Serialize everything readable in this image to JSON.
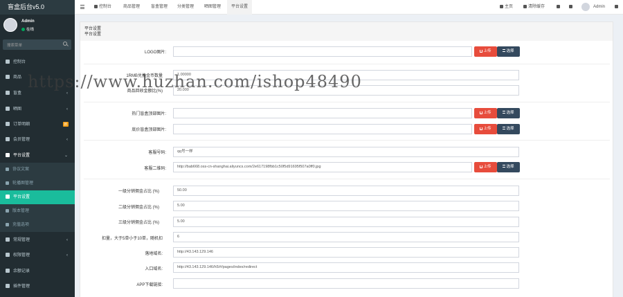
{
  "sidebar": {
    "logo": "盲盒后台v5.0",
    "user": {
      "name": "Admin",
      "status": "在线"
    },
    "search_placeholder": "搜索菜单",
    "items": [
      {
        "label": "控制台",
        "icon": "dashboard-icon"
      },
      {
        "label": "商品",
        "icon": "shopping-bag-icon"
      },
      {
        "label": "盲盒",
        "icon": "tag-icon",
        "caret": "‹"
      },
      {
        "label": "晒图",
        "icon": "image-icon",
        "caret": "‹"
      },
      {
        "label": "订单明细",
        "icon": "list-icon",
        "badge": "新"
      },
      {
        "label": "会员管理",
        "icon": "users-icon",
        "caret": "‹"
      },
      {
        "label": "平台设置",
        "icon": "gear-icon",
        "caret": "⌄"
      },
      {
        "label": "协议文案",
        "icon": "doc-icon"
      },
      {
        "label": "轮播图管理",
        "icon": "image-icon"
      },
      {
        "label": "平台设置",
        "icon": "gear-icon"
      },
      {
        "label": "版本管理",
        "icon": "version-icon"
      },
      {
        "label": "充值选项",
        "icon": "coin-icon"
      },
      {
        "label": "常规管理",
        "icon": "cogs-icon",
        "caret": "‹"
      },
      {
        "label": "权限管理",
        "icon": "users-icon",
        "caret": "‹"
      },
      {
        "label": "余额记录",
        "icon": "yen-icon"
      },
      {
        "label": "插件管理",
        "icon": "rocket-icon"
      }
    ]
  },
  "topbar": {
    "tabs": [
      "控制台",
      "商品管理",
      "盲盒管理",
      "分类管理",
      "晒图管理",
      "平台设置"
    ],
    "home": "主页",
    "clear_cache": "清除缓存",
    "user": "Admin"
  },
  "page": {
    "title": "平台设置",
    "subtitle": "平台设置"
  },
  "form": {
    "upload_label": "上传",
    "select_label": "选择",
    "fields": {
      "logo": {
        "label": "LOGO图片:",
        "value": ""
      },
      "rmb_rate": {
        "label": "1RMB兑换金币数量",
        "value": "1.00000"
      },
      "recycle": {
        "label": "商品回收金额比(%)",
        "value": "20.000"
      },
      "hot_img": {
        "label": "热门盲盒顶部图片:",
        "value": ""
      },
      "cheap_img": {
        "label": "底价盲盒顶部图片:",
        "value": ""
      },
      "service": {
        "label": "客服号码:",
        "value": "qq号一样"
      },
      "qrcode": {
        "label": "客服二维码:",
        "value": "http://bab668.oss-cn-shanghai.aliyuncs.com/2e617198fbb1c50f5d91695f507a0ff0.jpg"
      },
      "level1": {
        "label": "一级分销佣金占比 (%)",
        "value": "50.00"
      },
      "level2": {
        "label": "二级分销佣金占比 (%)",
        "value": "5.00"
      },
      "level3": {
        "label": "三级分销佣金占比 (%)",
        "value": "5.00"
      },
      "deduct": {
        "label": "扣量，大于5单小于10单，随机扣",
        "value": "6"
      },
      "landing": {
        "label": "落地域名:",
        "value": "http://43.143.129.146"
      },
      "entry": {
        "label": "入口域名:",
        "value": "http://43.143.129.146/h5/#/pages/index/redirect"
      },
      "app": {
        "label": "APP下载链接:",
        "value": ""
      }
    }
  },
  "watermark": "https://www.huzhan.com/ishop48490"
}
